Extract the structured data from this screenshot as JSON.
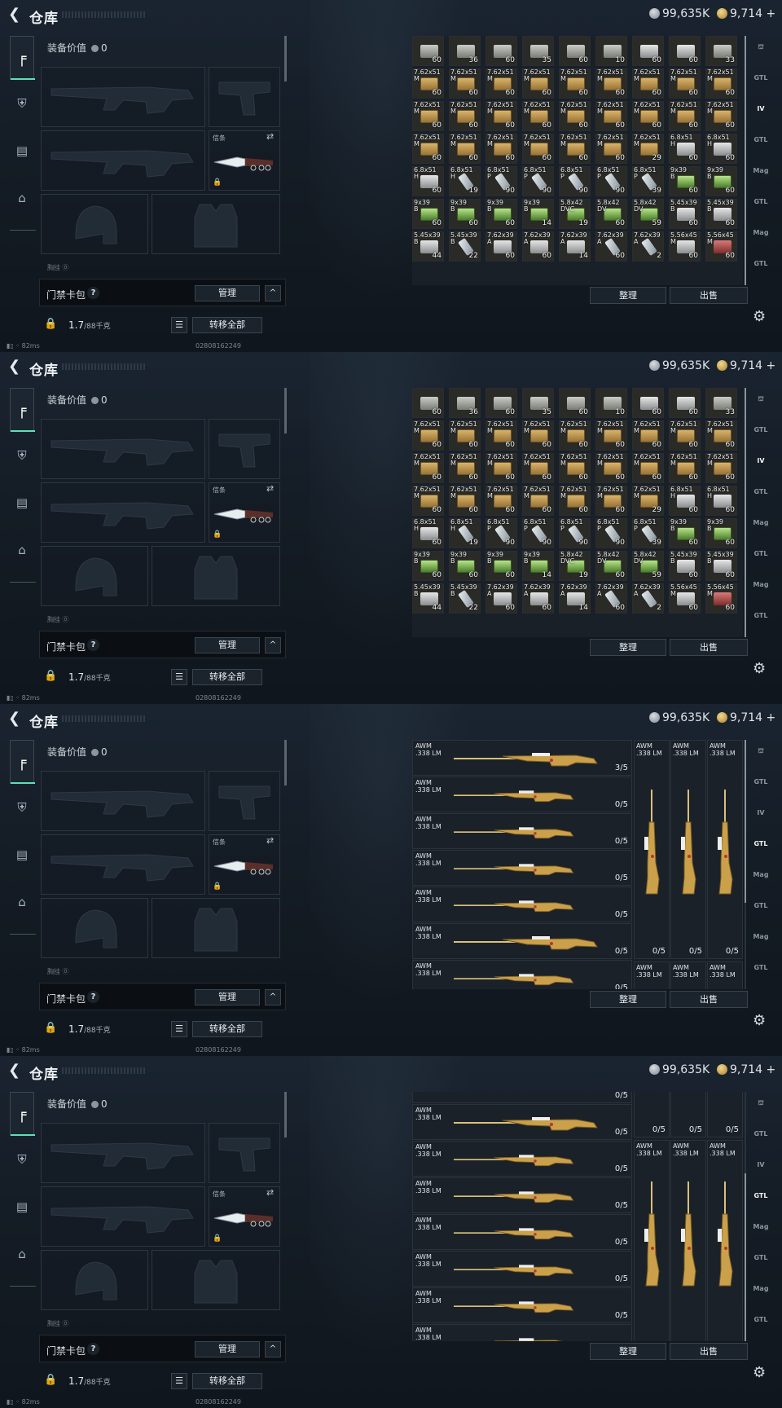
{
  "header": {
    "title": "仓库",
    "currency_silver": "99,635K",
    "currency_gold": "9,714 +"
  },
  "left_nav": {
    "items": [
      "weapon-tab",
      "armor-tab",
      "backpack-tab",
      "briefcase-tab"
    ]
  },
  "equipment": {
    "value_label": "装备价值",
    "value": "0",
    "knife_label": "信条",
    "divider_text": "胸挂  ⓪",
    "card_pack_label": "门禁卡包",
    "help": "?",
    "manage": "管理",
    "caret": "^",
    "weight": "1.7",
    "weight_cap": "/88千克",
    "move_all": "转移全部"
  },
  "status": {
    "ping": "82ms",
    "id": "02808162249"
  },
  "inventory_buttons": {
    "sort": "整理",
    "sell": "出售"
  },
  "right_nav": [
    "",
    "",
    "",
    "",
    "",
    "",
    "",
    ""
  ],
  "ammo_grid": {
    "rows": [
      [
        {
          "t": "",
          "n": "60",
          "c": "grey"
        },
        {
          "t": "",
          "n": "36",
          "c": "grey"
        },
        {
          "t": "",
          "n": "60",
          "c": "grey"
        },
        {
          "t": "",
          "n": "35",
          "c": "grey"
        },
        {
          "t": "",
          "n": "60",
          "c": "grey"
        },
        {
          "t": "",
          "n": "10",
          "c": "grey"
        },
        {
          "t": "",
          "n": "60",
          "c": "silver"
        },
        {
          "t": "",
          "n": "60",
          "c": "silver"
        },
        {
          "t": "",
          "n": "33",
          "c": "grey"
        }
      ],
      [
        {
          "t": "7.62x51\nM",
          "n": "60",
          "c": "box"
        },
        {
          "t": "7.62x51\nM",
          "n": "60",
          "c": "box"
        },
        {
          "t": "7.62x51\nM",
          "n": "60",
          "c": "box"
        },
        {
          "t": "7.62x51\nM",
          "n": "60",
          "c": "box"
        },
        {
          "t": "7.62x51\nM",
          "n": "60",
          "c": "box"
        },
        {
          "t": "7.62x51\nM",
          "n": "60",
          "c": "box"
        },
        {
          "t": "7.62x51\nM",
          "n": "60",
          "c": "box"
        },
        {
          "t": "7.62x51\nM",
          "n": "60",
          "c": "box"
        },
        {
          "t": "7.62x51\nM",
          "n": "60",
          "c": "box"
        }
      ],
      [
        {
          "t": "7.62x51\nM",
          "n": "60",
          "c": "box"
        },
        {
          "t": "7.62x51\nM",
          "n": "60",
          "c": "box"
        },
        {
          "t": "7.62x51\nM",
          "n": "60",
          "c": "box"
        },
        {
          "t": "7.62x51\nM",
          "n": "60",
          "c": "box"
        },
        {
          "t": "7.62x51\nM",
          "n": "60",
          "c": "box"
        },
        {
          "t": "7.62x51\nM",
          "n": "60",
          "c": "box"
        },
        {
          "t": "7.62x51\nM",
          "n": "60",
          "c": "box"
        },
        {
          "t": "7.62x51\nM",
          "n": "60",
          "c": "box"
        },
        {
          "t": "7.62x51\nM",
          "n": "60",
          "c": "box"
        }
      ],
      [
        {
          "t": "7.62x51\nM",
          "n": "60",
          "c": "box"
        },
        {
          "t": "7.62x51\nM",
          "n": "60",
          "c": "box"
        },
        {
          "t": "7.62x51\nM",
          "n": "60",
          "c": "box"
        },
        {
          "t": "7.62x51\nM",
          "n": "60",
          "c": "box"
        },
        {
          "t": "7.62x51\nM",
          "n": "60",
          "c": "box"
        },
        {
          "t": "7.62x51\nM",
          "n": "60",
          "c": "box"
        },
        {
          "t": "7.62x51\nM",
          "n": "29",
          "c": "box"
        },
        {
          "t": "6.8x51\nH",
          "n": "60",
          "c": "silver"
        },
        {
          "t": "6.8x51\nH",
          "n": "60",
          "c": "silver"
        }
      ],
      [
        {
          "t": "6.8x51\nH",
          "n": "60",
          "c": "silver"
        },
        {
          "t": "6.8x51\nH",
          "n": "19",
          "c": "mag"
        },
        {
          "t": "6.8x51\nP",
          "n": "90",
          "c": "mag"
        },
        {
          "t": "6.8x51\nP",
          "n": "90",
          "c": "mag"
        },
        {
          "t": "6.8x51\nP",
          "n": "90",
          "c": "mag"
        },
        {
          "t": "6.8x51\nP",
          "n": "90",
          "c": "mag"
        },
        {
          "t": "6.8x51\nP",
          "n": "39",
          "c": "mag"
        },
        {
          "t": "9x39\nB",
          "n": "60",
          "c": "green"
        },
        {
          "t": "9x39\nB",
          "n": "60",
          "c": "green"
        }
      ],
      [
        {
          "t": "9x39\nB",
          "n": "60",
          "c": "green"
        },
        {
          "t": "9x39\nB",
          "n": "60",
          "c": "green"
        },
        {
          "t": "9x39\nB",
          "n": "60",
          "c": "green"
        },
        {
          "t": "9x39\nB",
          "n": "14",
          "c": "green"
        },
        {
          "t": "5.8x42\nDVC",
          "n": "19",
          "c": "green"
        },
        {
          "t": "5.8x42\nDV",
          "n": "60",
          "c": "green"
        },
        {
          "t": "5.8x42\nDV",
          "n": "59",
          "c": "green"
        },
        {
          "t": "5.45x39\nB",
          "n": "60",
          "c": "silver"
        },
        {
          "t": "5.45x39\nB",
          "n": "60",
          "c": "silver"
        }
      ],
      [
        {
          "t": "5.45x39\nB",
          "n": "44",
          "c": "silver"
        },
        {
          "t": "5.45x39\nB",
          "n": "22",
          "c": "mag"
        },
        {
          "t": "7.62x39\nA",
          "n": "60",
          "c": "silver"
        },
        {
          "t": "7.62x39\nA",
          "n": "60",
          "c": "silver"
        },
        {
          "t": "7.62x39\nA",
          "n": "14",
          "c": "silver"
        },
        {
          "t": "7.62x39\nA",
          "n": "60",
          "c": "mag"
        },
        {
          "t": "7.62x39\nA",
          "n": "2",
          "c": "mag"
        },
        {
          "t": "5.56x45\nM",
          "n": "60",
          "c": "silver"
        },
        {
          "t": "5.56x45\nM",
          "n": "60",
          "c": "red"
        }
      ]
    ]
  },
  "weapon_list_3": {
    "rows": [
      {
        "t": "AWM\n.338 LM",
        "n": "3/5"
      },
      {
        "t": "AWM\n.338 LM",
        "n": "0/5"
      },
      {
        "t": "AWM\n.338 LM",
        "n": "0/5"
      },
      {
        "t": "AWM\n.338 LM",
        "n": "0/5"
      },
      {
        "t": "AWM\n.338 LM",
        "n": "0/5"
      },
      {
        "t": "AWM\n.338 LM",
        "n": "0/5"
      },
      {
        "t": "AWM\n.338 LM",
        "n": "0/5"
      }
    ],
    "cols": [
      {
        "t": "AWM\n.338 LM",
        "n": "0/5"
      },
      {
        "t": "AWM\n.338 LM",
        "n": "0/5"
      },
      {
        "t": "AWM\n.338 LM",
        "n": "0/5"
      }
    ],
    "cols_bottom": [
      {
        "t": "AWM\n.338 LM"
      },
      {
        "t": "AWM\n.338 LM"
      },
      {
        "t": "AWM\n.338 LM"
      }
    ]
  },
  "weapon_list_4": {
    "top_count": "0/5",
    "rows": [
      {
        "t": "AWM\n.338 LM",
        "n": "0/5"
      },
      {
        "t": "AWM\n.338 LM",
        "n": "0/5"
      },
      {
        "t": "AWM\n.338 LM",
        "n": "0/5"
      },
      {
        "t": "AWM\n.338 LM",
        "n": "0/5"
      },
      {
        "t": "AWM\n.338 LM",
        "n": "0/5"
      },
      {
        "t": "AWM\n.338 LM",
        "n": "0/5"
      },
      {
        "t": "AWM\n.338 LM",
        "n": "0/5"
      }
    ],
    "cols_top": [
      {
        "n": "0/5"
      },
      {
        "n": "0/5"
      },
      {
        "n": "0/5"
      }
    ],
    "cols": [
      {
        "t": "AWM\n.338 LM",
        "n": "0/5"
      },
      {
        "t": "AWM\n.338 LM",
        "n": "0/5"
      },
      {
        "t": "AWM\n.338 LM",
        "n": "0/5"
      }
    ]
  },
  "colors": {
    "accent": "#5fe0b4",
    "box": "#c9a35a",
    "bg": "#141a21"
  }
}
